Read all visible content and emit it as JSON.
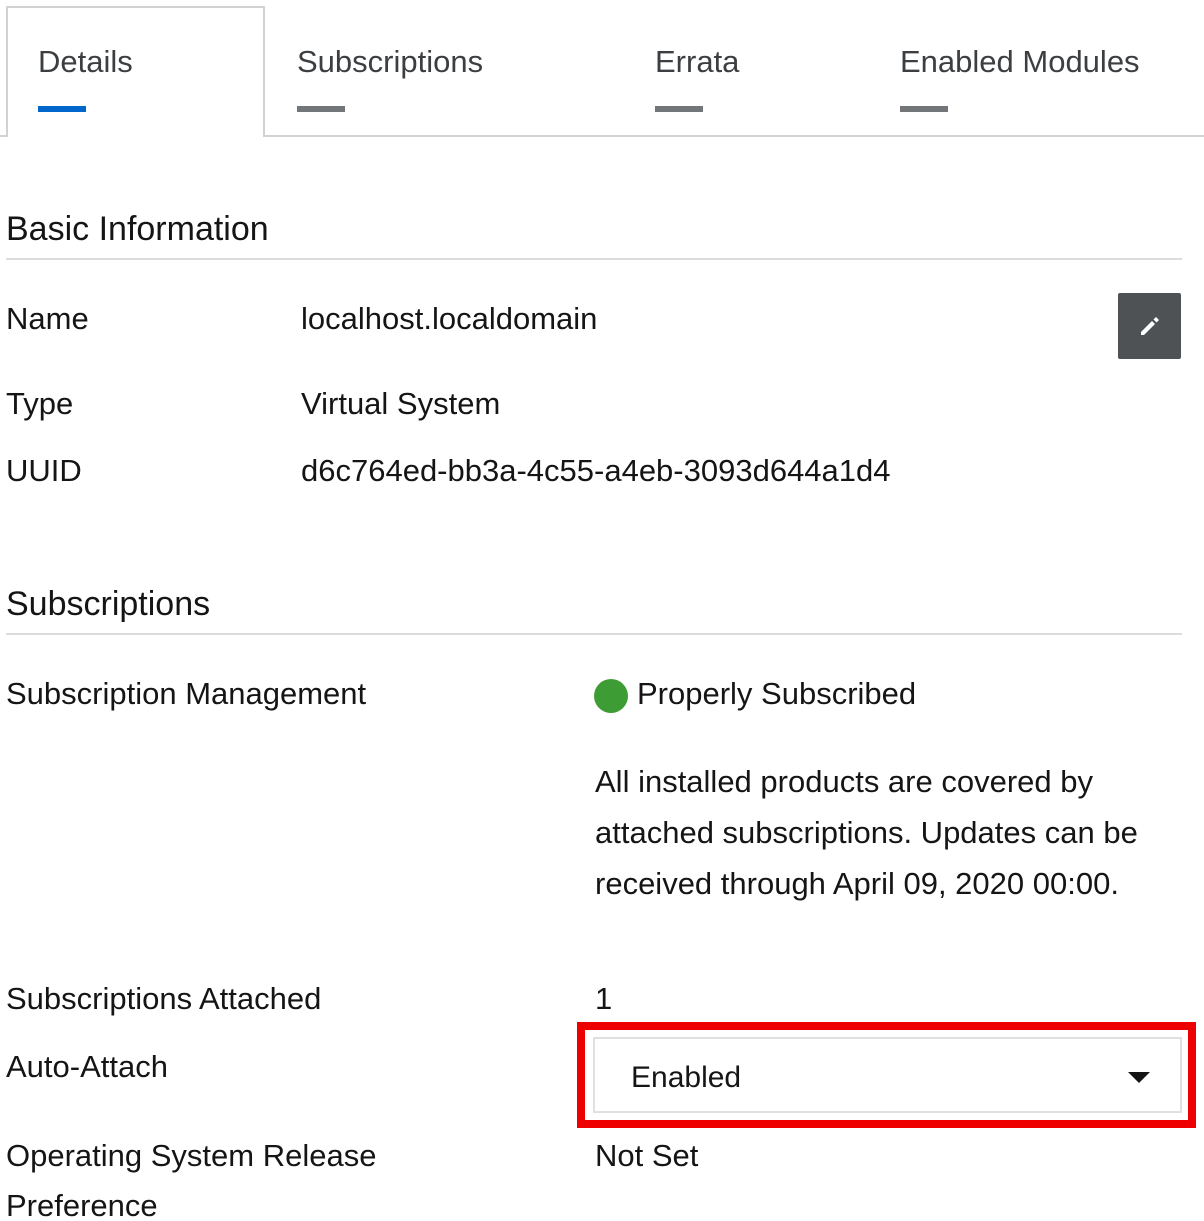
{
  "tabs": [
    {
      "label": "Details",
      "active": true
    },
    {
      "label": "Subscriptions",
      "active": false
    },
    {
      "label": "Errata",
      "active": false
    },
    {
      "label": "Enabled Modules",
      "active": false
    }
  ],
  "basic_info": {
    "title": "Basic Information",
    "name_label": "Name",
    "name_value": "localhost.localdomain",
    "type_label": "Type",
    "type_value": "Virtual System",
    "uuid_label": "UUID",
    "uuid_value": "d6c764ed-bb3a-4c55-a4eb-3093d644a1d4",
    "edit_icon": "pencil-icon"
  },
  "subscriptions": {
    "title": "Subscriptions",
    "management_label": "Subscription Management",
    "status_text": "Properly Subscribed",
    "status_color": "#3e9c35",
    "status_description": "All installed products are covered by attached subscriptions. Updates can be received through April 09, 2020 00:00.",
    "attached_label": "Subscriptions Attached",
    "attached_value": "1",
    "auto_attach_label": "Auto-Attach",
    "auto_attach_value": "Enabled",
    "os_release_label_line1": "Operating System Release",
    "os_release_label_line2": "Preference",
    "os_release_value": "Not Set"
  },
  "colors": {
    "active_tab_accent": "#0066cc",
    "inactive_tab_bar": "#737679",
    "highlight_border": "#ee0000",
    "edit_button_bg": "#4f5255"
  }
}
